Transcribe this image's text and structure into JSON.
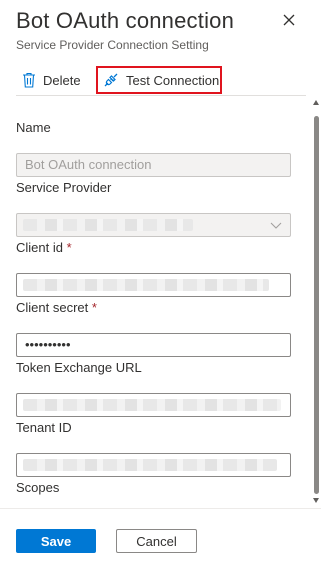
{
  "header": {
    "title": "Bot OAuth connection",
    "subtitle": "Service Provider Connection Setting"
  },
  "toolbar": {
    "delete_label": "Delete",
    "test_label": "Test Connection"
  },
  "form": {
    "name": {
      "label": "Name",
      "value": "Bot OAuth connection"
    },
    "service_provider": {
      "label": "Service Provider"
    },
    "client_id": {
      "label": "Client id",
      "required": "*"
    },
    "client_secret": {
      "label": "Client secret",
      "required": "*",
      "value": "••••••••••"
    },
    "token_exchange_url": {
      "label": "Token Exchange URL"
    },
    "tenant_id": {
      "label": "Tenant ID"
    },
    "scopes": {
      "label": "Scopes"
    }
  },
  "footer": {
    "save_label": "Save",
    "cancel_label": "Cancel"
  },
  "colors": {
    "primary": "#0078d4",
    "highlight_border": "#e0141e",
    "required": "#a4262c"
  }
}
